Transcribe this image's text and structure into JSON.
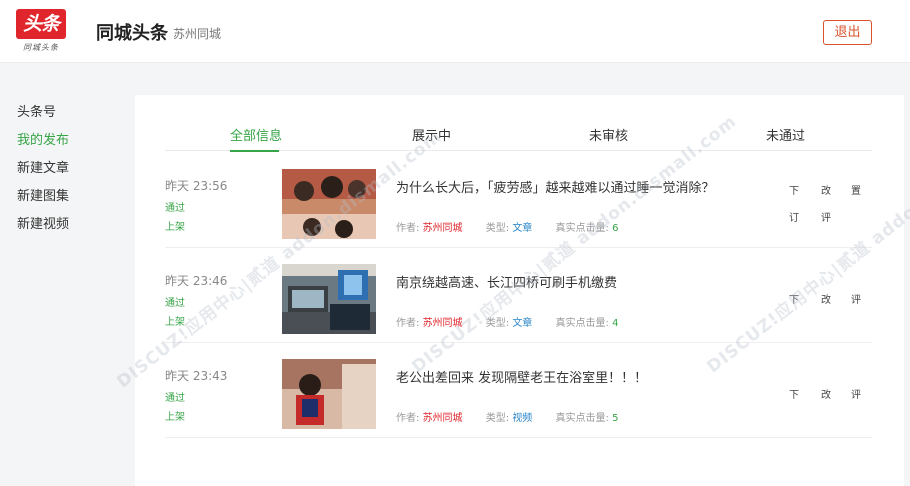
{
  "header": {
    "logo_text": "头条",
    "logo_sub": "同城头条",
    "title": "同城头条",
    "subtitle": "苏州同城",
    "logout_label": "退出"
  },
  "sidebar": {
    "items": [
      {
        "label": "头条号",
        "active": false
      },
      {
        "label": "我的发布",
        "active": true
      },
      {
        "label": "新建文章",
        "active": false
      },
      {
        "label": "新建图集",
        "active": false
      },
      {
        "label": "新建视频",
        "active": false
      }
    ]
  },
  "tabs": [
    {
      "label": "全部信息",
      "active": true
    },
    {
      "label": "展示中",
      "active": false
    },
    {
      "label": "未审核",
      "active": false
    },
    {
      "label": "未通过",
      "active": false
    }
  ],
  "posts": [
    {
      "time": "昨天 23:56",
      "status1": "通过",
      "status2": "上架",
      "title": "为什么长大后，「疲劳感」越来越难以通过睡一觉消除？",
      "author_label": "作者:",
      "author": "苏州同城",
      "type_label": "类型:",
      "type": "文章",
      "clicks_label": "真实点击量:",
      "clicks": "6",
      "actions": [
        "下",
        "改",
        "置",
        "订",
        "评"
      ]
    },
    {
      "time": "昨天 23:46",
      "status1": "通过",
      "status2": "上架",
      "title": "南京绕越高速、长江四桥可刷手机缴费",
      "author_label": "作者:",
      "author": "苏州同城",
      "type_label": "类型:",
      "type": "文章",
      "clicks_label": "真实点击量:",
      "clicks": "4",
      "actions": [
        "下",
        "改",
        "评"
      ]
    },
    {
      "time": "昨天 23:43",
      "status1": "通过",
      "status2": "上架",
      "title": "老公出差回来 发现隔壁老王在浴室里！！！",
      "author_label": "作者:",
      "author": "苏州同城",
      "type_label": "类型:",
      "type": "视频",
      "clicks_label": "真实点击量:",
      "clicks": "5",
      "actions": [
        "下",
        "改",
        "评"
      ]
    }
  ],
  "watermark": "DISCUZ!应用中心|贰道 addon.dismall.com",
  "colors": {
    "accent_green": "#37a447",
    "brand_red": "#e0262c",
    "link_blue": "#2a85c8",
    "logout_orange": "#d9532b"
  }
}
